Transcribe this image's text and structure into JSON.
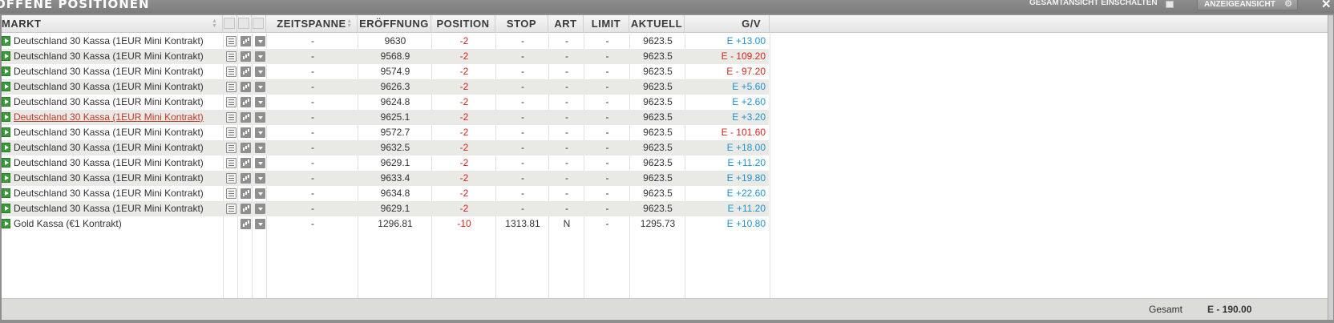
{
  "window": {
    "title": "OFFENE POSITIONEN",
    "overview_toggle_label": "GESAMTANSICHT EINSCHALTEN",
    "view_button_label": "ANZEIGEANSICHT",
    "close_glyph": "✕"
  },
  "table": {
    "headers": {
      "market": "MARKT",
      "period": "ZEITSPANNE",
      "opening": "ERÖFFNUNG",
      "position": "POSITION",
      "stop": "STOP",
      "type": "ART",
      "limit": "LIMIT",
      "current": "AKTUELL",
      "pl": "G/V"
    },
    "rows": [
      {
        "market": "Deutschland 30 Kassa (1EUR Mini Kontrakt)",
        "period": "-",
        "opening": "9630",
        "position": "-2",
        "stop": "-",
        "type": "-",
        "limit": "-",
        "current": "9623.5",
        "pl": "E +13.00",
        "pl_sign": "pos"
      },
      {
        "market": "Deutschland 30 Kassa (1EUR Mini Kontrakt)",
        "period": "-",
        "opening": "9568.9",
        "position": "-2",
        "stop": "-",
        "type": "-",
        "limit": "-",
        "current": "9623.5",
        "pl": "E - 109.20",
        "pl_sign": "neg"
      },
      {
        "market": "Deutschland 30 Kassa (1EUR Mini Kontrakt)",
        "period": "-",
        "opening": "9574.9",
        "position": "-2",
        "stop": "-",
        "type": "-",
        "limit": "-",
        "current": "9623.5",
        "pl": "E - 97.20",
        "pl_sign": "neg"
      },
      {
        "market": "Deutschland 30 Kassa (1EUR Mini Kontrakt)",
        "period": "-",
        "opening": "9626.3",
        "position": "-2",
        "stop": "-",
        "type": "-",
        "limit": "-",
        "current": "9623.5",
        "pl": "E +5.60",
        "pl_sign": "pos"
      },
      {
        "market": "Deutschland 30 Kassa (1EUR Mini Kontrakt)",
        "period": "-",
        "opening": "9624.8",
        "position": "-2",
        "stop": "-",
        "type": "-",
        "limit": "-",
        "current": "9623.5",
        "pl": "E +2.60",
        "pl_sign": "pos"
      },
      {
        "market": "Deutschland 30 Kassa (1EUR Mini Kontrakt)",
        "period": "-",
        "opening": "9625.1",
        "position": "-2",
        "stop": "-",
        "type": "-",
        "limit": "-",
        "current": "9623.5",
        "pl": "E +3.20",
        "pl_sign": "pos",
        "hovered": true
      },
      {
        "market": "Deutschland 30 Kassa (1EUR Mini Kontrakt)",
        "period": "-",
        "opening": "9572.7",
        "position": "-2",
        "stop": "-",
        "type": "-",
        "limit": "-",
        "current": "9623.5",
        "pl": "E - 101.60",
        "pl_sign": "neg"
      },
      {
        "market": "Deutschland 30 Kassa (1EUR Mini Kontrakt)",
        "period": "-",
        "opening": "9632.5",
        "position": "-2",
        "stop": "-",
        "type": "-",
        "limit": "-",
        "current": "9623.5",
        "pl": "E +18.00",
        "pl_sign": "pos"
      },
      {
        "market": "Deutschland 30 Kassa (1EUR Mini Kontrakt)",
        "period": "-",
        "opening": "9629.1",
        "position": "-2",
        "stop": "-",
        "type": "-",
        "limit": "-",
        "current": "9623.5",
        "pl": "E +11.20",
        "pl_sign": "pos"
      },
      {
        "market": "Deutschland 30 Kassa (1EUR Mini Kontrakt)",
        "period": "-",
        "opening": "9633.4",
        "position": "-2",
        "stop": "-",
        "type": "-",
        "limit": "-",
        "current": "9623.5",
        "pl": "E +19.80",
        "pl_sign": "pos"
      },
      {
        "market": "Deutschland 30 Kassa (1EUR Mini Kontrakt)",
        "period": "-",
        "opening": "9634.8",
        "position": "-2",
        "stop": "-",
        "type": "-",
        "limit": "-",
        "current": "9623.5",
        "pl": "E +22.60",
        "pl_sign": "pos"
      },
      {
        "market": "Deutschland 30 Kassa (1EUR Mini Kontrakt)",
        "period": "-",
        "opening": "9629.1",
        "position": "-2",
        "stop": "-",
        "type": "-",
        "limit": "-",
        "current": "9623.5",
        "pl": "E +11.20",
        "pl_sign": "pos"
      },
      {
        "market": "Gold Kassa (€1 Kontrakt)",
        "period": "-",
        "opening": "1296.81",
        "position": "-10",
        "stop": "1313.81",
        "type": "N",
        "limit": "-",
        "current": "1295.73",
        "pl": "E +10.80",
        "pl_sign": "pos",
        "no_info_icon": true
      }
    ]
  },
  "footer": {
    "total_label": "Gesamt",
    "total_value": "E - 190.00"
  },
  "icons": {
    "row_expand": "play-icon",
    "info": "info-sheet-icon",
    "chart": "chart-icon",
    "menu": "dropdown-icon",
    "gear": "gear-icon"
  },
  "colors": {
    "positive": "#1f92d2",
    "negative": "#d9241c",
    "row_alt": "#e9e9e5",
    "play_green": "#3b9b3b"
  }
}
